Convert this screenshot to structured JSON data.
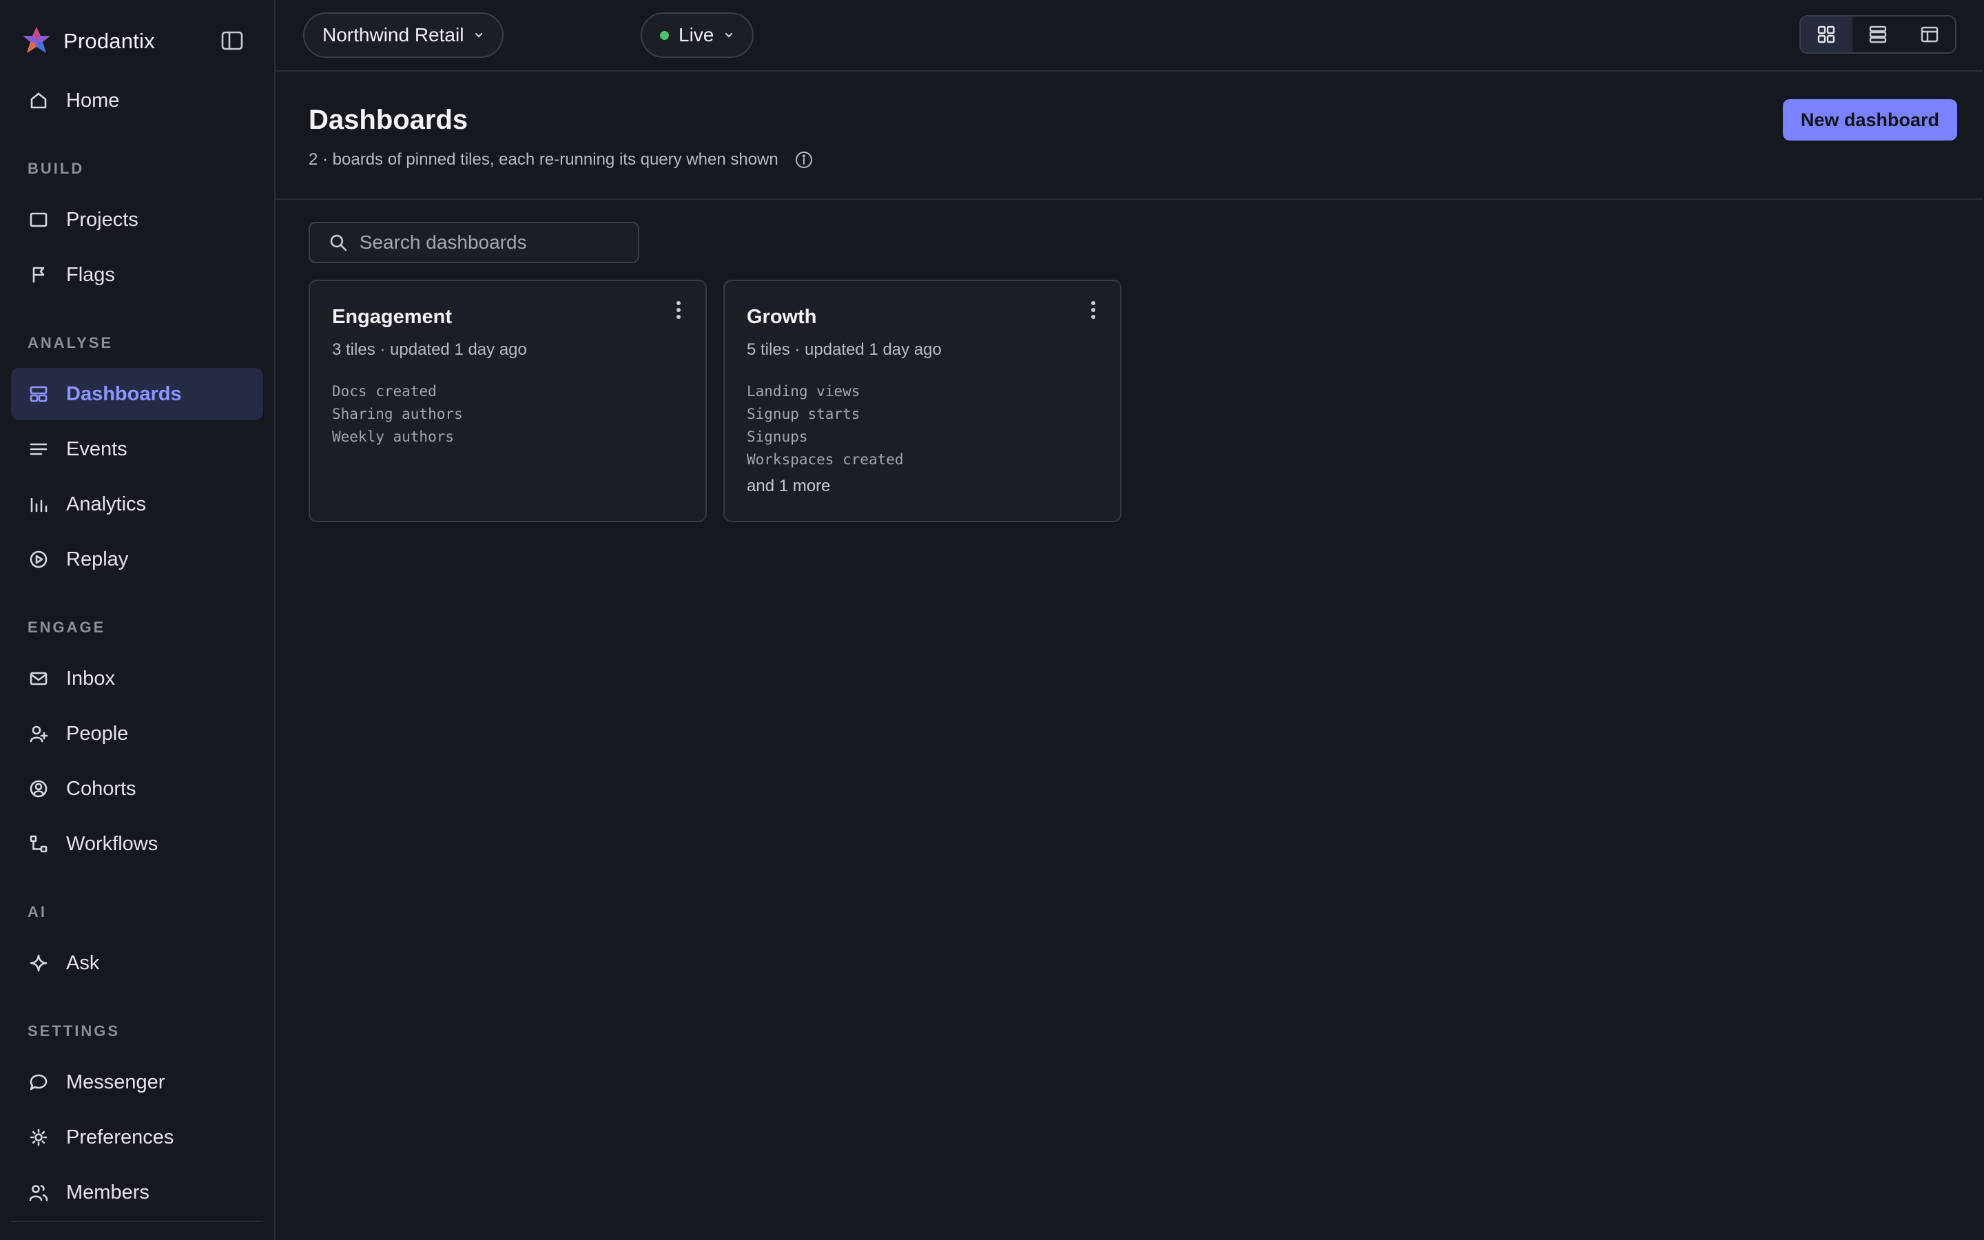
{
  "app": {
    "name": "Prodantix"
  },
  "sidebar": {
    "home": {
      "label": "Home"
    },
    "sections": {
      "build": "BUILD",
      "analyse": "ANALYSE",
      "engage": "ENGAGE",
      "ai": "AI",
      "settings": "SETTINGS"
    },
    "items": {
      "projects": "Projects",
      "flags": "Flags",
      "dashboards": "Dashboards",
      "events": "Events",
      "analytics": "Analytics",
      "replay": "Replay",
      "inbox": "Inbox",
      "people": "People",
      "cohorts": "Cohorts",
      "workflows": "Workflows",
      "ask": "Ask",
      "messenger": "Messenger",
      "preferences": "Preferences",
      "members": "Members"
    },
    "active": "dashboards"
  },
  "topbar": {
    "workspace": "Northwind Retail",
    "environment": "Live",
    "environment_status_color": "#4cc06a",
    "view_modes": [
      "grid-view-icon",
      "list-view-icon",
      "board-view-icon"
    ],
    "active_view": "grid"
  },
  "page": {
    "title": "Dashboards",
    "subtitle": "2 · boards of pinned tiles, each re-running its query when shown",
    "new_button": "New dashboard"
  },
  "search": {
    "placeholder": "Search dashboards",
    "value": ""
  },
  "dashboards": [
    {
      "title": "Engagement",
      "meta": "3 tiles · updated 1 day ago",
      "tiles": [
        "Docs created",
        "Sharing authors",
        "Weekly authors"
      ],
      "more": ""
    },
    {
      "title": "Growth",
      "meta": "5 tiles · updated 1 day ago",
      "tiles": [
        "Landing views",
        "Signup starts",
        "Signups",
        "Workspaces created"
      ],
      "more": "and 1 more"
    }
  ],
  "colors": {
    "accent": "#7b82ff",
    "active_nav_bg": "#252b45",
    "background": "#15181e"
  }
}
